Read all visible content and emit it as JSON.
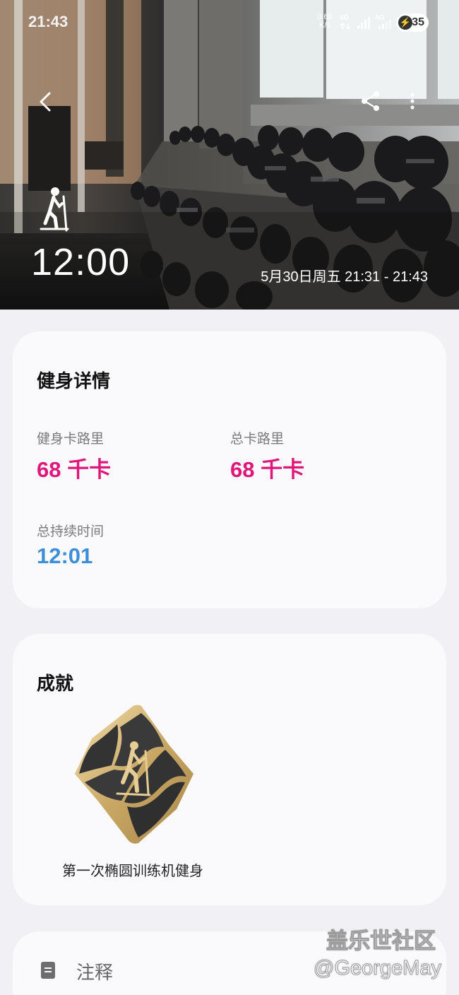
{
  "status_bar": {
    "time": "21:43",
    "net_speed_value": "0.68",
    "net_speed_unit": "K/s",
    "signal1_label": "4G",
    "signal2_label": "4G",
    "battery": "35"
  },
  "hero": {
    "duration": "12:00",
    "date_range": "5月30日周五 21:31 - 21:43",
    "activity_icon": "elliptical-walker-icon"
  },
  "details": {
    "title": "健身详情",
    "workout_calories_label": "健身卡路里",
    "workout_calories_value": "68 千卡",
    "total_calories_label": "总卡路里",
    "total_calories_value": "68 千卡",
    "total_duration_label": "总持续时间",
    "total_duration_value": "12:01",
    "colors": {
      "calories": "#e0167b",
      "duration": "#3d8ed8"
    }
  },
  "achievements": {
    "title": "成就",
    "badge_name": "第一次椭圆训练机健身"
  },
  "notes": {
    "label": "注释"
  },
  "watermark": {
    "site": "盖乐世社区",
    "user": "@GeorgeMay"
  }
}
